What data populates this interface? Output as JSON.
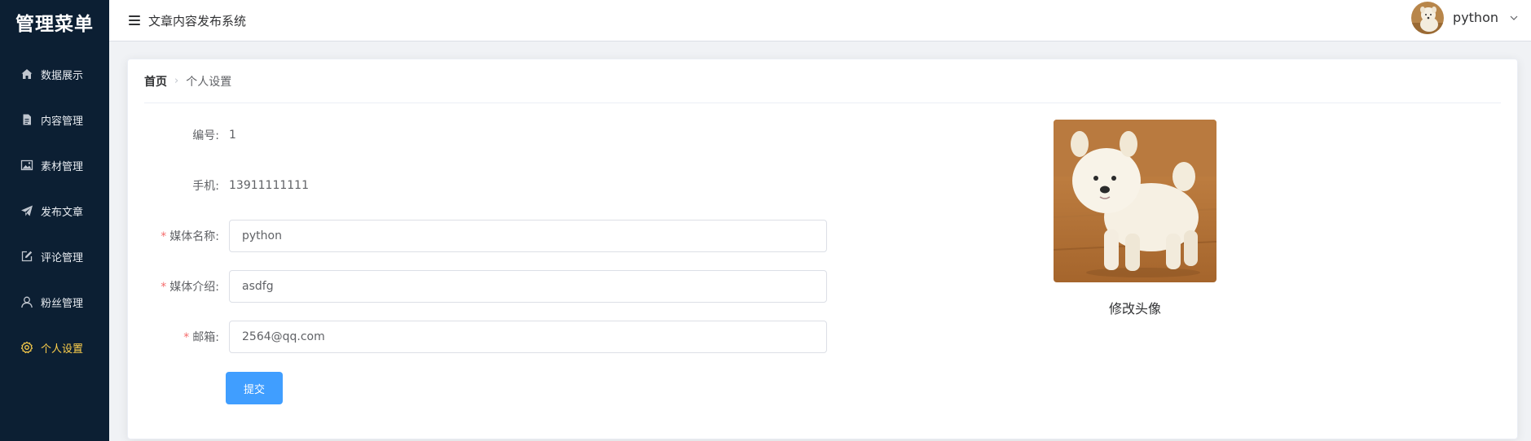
{
  "sidebar": {
    "brand": "管理菜单",
    "items": [
      {
        "label": "数据展示",
        "icon": "home-icon"
      },
      {
        "label": "内容管理",
        "icon": "document-icon"
      },
      {
        "label": "素材管理",
        "icon": "picture-icon"
      },
      {
        "label": "发布文章",
        "icon": "send-icon"
      },
      {
        "label": "评论管理",
        "icon": "edit-icon"
      },
      {
        "label": "粉丝管理",
        "icon": "user-icon"
      },
      {
        "label": "个人设置",
        "icon": "setting-icon",
        "active": true
      }
    ],
    "active_color": "#ffd04b",
    "background": "#0c1f33"
  },
  "header": {
    "title": "文章内容发布系统",
    "menu_icon": "hamburger-icon",
    "user_name": "python",
    "dropdown_icon": "chevron-down-icon"
  },
  "breadcrumb": {
    "home": "首页",
    "separator": "›",
    "current": "个人设置"
  },
  "form": {
    "id_label": "编号:",
    "id_value": "1",
    "phone_label": "手机:",
    "phone_value": "13911111111",
    "name_label": "媒体名称:",
    "name_value": "python",
    "intro_label": "媒体介绍:",
    "intro_value": "asdfg",
    "email_label": "邮箱:",
    "email_value": "2564@qq.com",
    "required_mark": "*",
    "submit_label": "提交"
  },
  "avatar": {
    "caption": "修改头像"
  },
  "colors": {
    "primary": "#409eff",
    "required": "#f56c6c"
  }
}
